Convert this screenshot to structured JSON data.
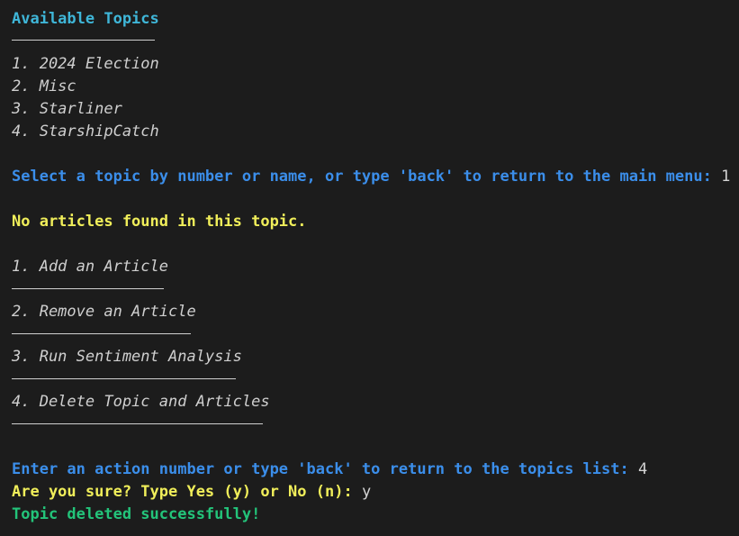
{
  "terminal": {
    "header": "Available Topics",
    "topics": [
      "1. 2024 Election",
      "2. Misc",
      "3. Starliner",
      "4. StarshipCatch"
    ],
    "select_prompt": "Select a topic by number or name, or type 'back' to return to the main menu:",
    "select_input": "1",
    "no_articles_msg": "No articles found in this topic.",
    "actions": [
      "1. Add an Article",
      "2. Remove an Article",
      "3. Run Sentiment Analysis",
      "4. Delete Topic and Articles"
    ],
    "action_prompt": "Enter an action number or type 'back' to return to the topics list:",
    "action_input": "4",
    "confirm_prompt": "Are you sure? Type Yes (y) or No (n):",
    "confirm_input": "y",
    "success_msg": "Topic deleted successfully!"
  },
  "colors": {
    "background": "#1c1c1c",
    "header": "#3fb6d8",
    "prompt": "#3b8eea",
    "warning": "#f0ee5a",
    "success": "#23c47a",
    "text": "#cfcfcf"
  }
}
